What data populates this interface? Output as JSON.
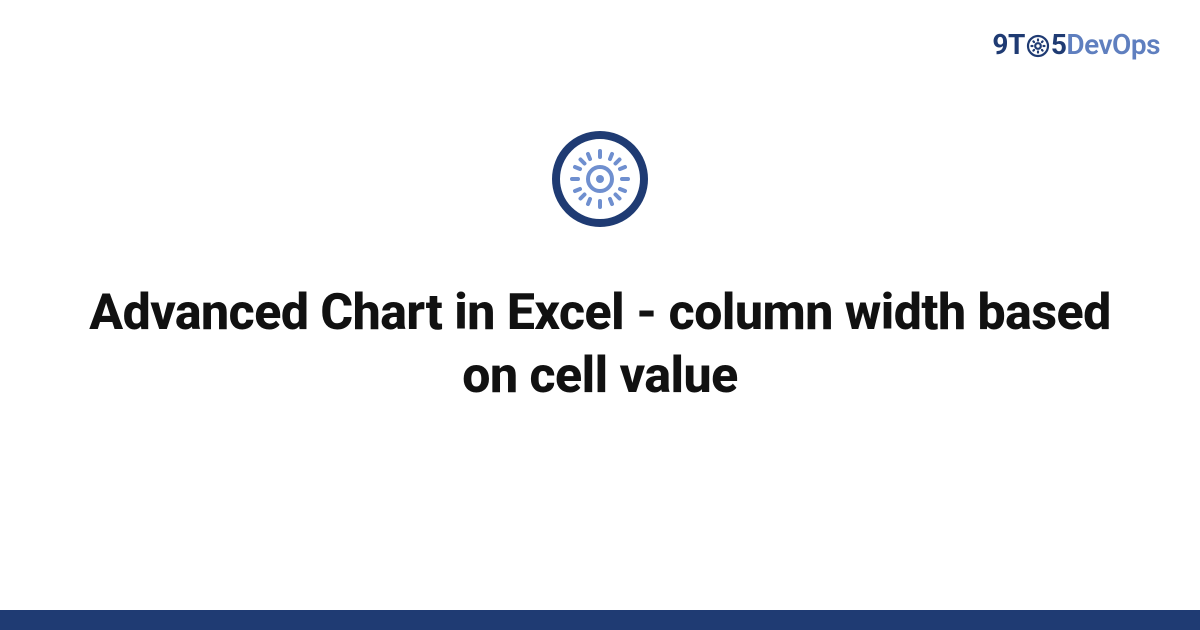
{
  "brand": {
    "part1": "9T",
    "part2": "5",
    "part3": "DevOps",
    "icon_name": "gear-icon"
  },
  "hero": {
    "icon_name": "gear-icon",
    "title": "Advanced Chart in Excel - column width based on cell value"
  },
  "colors": {
    "brand_dark": "#1f3b73",
    "brand_light": "#5f7fbf",
    "footer": "#1f3b73"
  }
}
